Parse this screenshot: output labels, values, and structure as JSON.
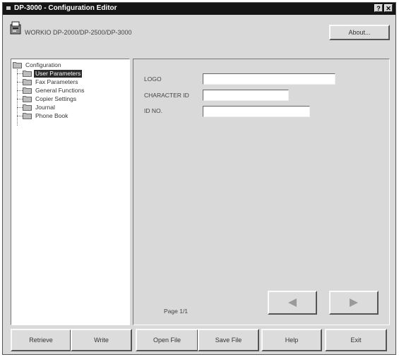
{
  "window": {
    "title": "DP-3000 - Configuration Editor",
    "help_button": "?",
    "close_button": "✕"
  },
  "header": {
    "device_label": "WORKIO DP-2000/DP-2500/DP-3000",
    "about_label": "About..."
  },
  "tree": {
    "root": "Configuration",
    "items": [
      {
        "label": "User Parameters",
        "selected": true
      },
      {
        "label": "Fax Parameters",
        "selected": false
      },
      {
        "label": "General Functions",
        "selected": false
      },
      {
        "label": "Copier Settings",
        "selected": false
      },
      {
        "label": "Journal",
        "selected": false
      },
      {
        "label": "Phone Book",
        "selected": false
      }
    ]
  },
  "form": {
    "fields": [
      {
        "label": "LOGO",
        "value": ""
      },
      {
        "label": "CHARACTER ID",
        "value": ""
      },
      {
        "label": "ID NO.",
        "value": ""
      }
    ]
  },
  "pagination": {
    "page_text": "Page 1/1",
    "prev_icon": "triangle-left",
    "next_icon": "triangle-right"
  },
  "footer": {
    "buttons": [
      "Retrieve",
      "Write",
      "Open File",
      "Save File",
      "Help",
      "Exit"
    ]
  }
}
